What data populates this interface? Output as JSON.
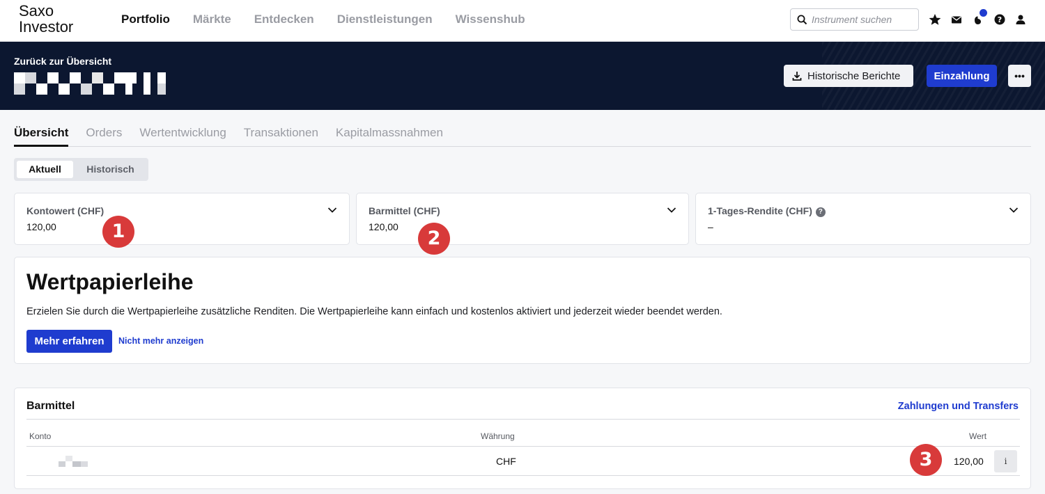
{
  "app": {
    "logo_line1": "Saxo",
    "logo_line2": "Investor"
  },
  "nav": {
    "items": [
      "Portfolio",
      "Märkte",
      "Entdecken",
      "Dienstleistungen",
      "Wissenshub"
    ],
    "active": "Portfolio"
  },
  "search": {
    "placeholder": "Instrument suchen"
  },
  "top_icons": [
    "search-icon",
    "star-icon",
    "mail-icon",
    "notification-icon",
    "help-icon",
    "user-icon"
  ],
  "header": {
    "back_link": "Zurück zur Übersicht",
    "historical_reports_label": "Historische Berichte",
    "deposit_label": "Einzahlung",
    "more_label": "•••"
  },
  "tabs": [
    "Übersicht",
    "Orders",
    "Wertentwicklung",
    "Transaktionen",
    "Kapitalmassnahmen"
  ],
  "segmented": {
    "current": "Aktuell",
    "historical": "Historisch"
  },
  "metrics": [
    {
      "label": "Kontowert (CHF)",
      "value": "120,00",
      "badge": "1"
    },
    {
      "label": "Barmittel (CHF)",
      "value": "120,00",
      "badge": "2"
    },
    {
      "label": "1-Tages-Rendite (CHF)",
      "value": "–",
      "help": "?"
    }
  ],
  "promo": {
    "title": "Wertpapierleihe",
    "text": "Erzielen Sie durch die Wertpapierleihe zusätzliche Renditen. Die Wertpapierleihe kann einfach und kostenlos aktiviert und jederzeit wieder beendet werden.",
    "learn_more": "Mehr erfahren",
    "dismiss": "Nicht mehr anzeigen"
  },
  "cash": {
    "title": "Barmittel",
    "link": "Zahlungen und Transfers",
    "columns": {
      "account": "Konto",
      "currency": "Währung",
      "value": "Wert"
    },
    "rows": [
      {
        "currency": "CHF",
        "value": "120,00",
        "badge": "3",
        "info": "i"
      }
    ]
  },
  "colors": {
    "brand_blue": "#1f3ccf",
    "header_dark": "#0c1730",
    "badge_red": "#d83a3a"
  }
}
